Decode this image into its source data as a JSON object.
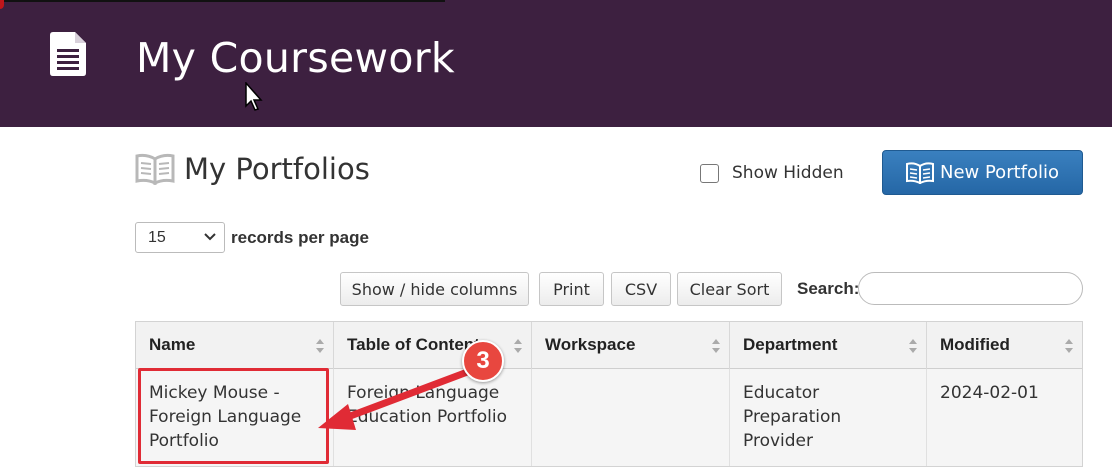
{
  "header": {
    "title": "My Coursework",
    "icon": "document-icon",
    "background_color": "#3d2040"
  },
  "portfolios": {
    "title": "My Portfolios",
    "icon": "book-icon",
    "show_hidden_label": "Show Hidden",
    "show_hidden_checked": false,
    "new_button_label": "New Portfolio",
    "accent_color": "#2c6fb0"
  },
  "pagination": {
    "records_per_page_value": "15",
    "records_per_page_label": "records per page"
  },
  "toolbar": {
    "show_hide_columns": "Show / hide columns",
    "print": "Print",
    "csv": "CSV",
    "clear_sort": "Clear Sort",
    "search_label": "Search:",
    "search_value": ""
  },
  "table": {
    "columns": [
      "Name",
      "Table of Contents",
      "Workspace",
      "Department",
      "Modified"
    ],
    "rows": [
      {
        "name": "Mickey Mouse - Foreign Language Portfolio",
        "table_of_contents": "Foreign Language Education Portfolio",
        "workspace": "",
        "department": "Educator Preparation Provider",
        "modified": "2024-02-01"
      }
    ]
  },
  "annotation": {
    "step_number": "3",
    "color": "#e02b35"
  }
}
